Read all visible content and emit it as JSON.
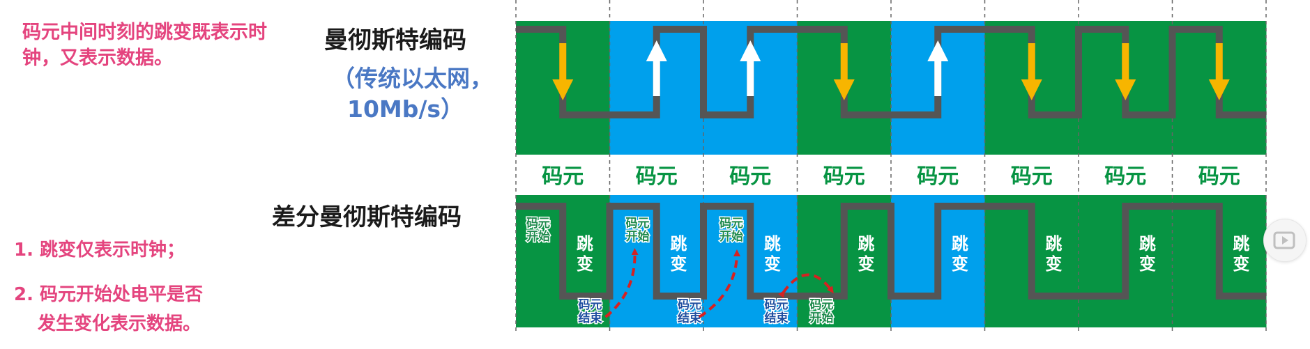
{
  "notes": {
    "manchester_note": "码元中间时刻的跳变既表示时钟，又表示数据。",
    "diff_rule_1": "1. 跳变仅表示时钟；",
    "diff_rule_2_line1": "2. 码元开始处电平是否",
    "diff_rule_2_line2": "发生变化表示数据。"
  },
  "manchester": {
    "title": "曼彻斯特编码",
    "subtitle_line1": "（传统以太网，",
    "subtitle_line2": "10Mb/s）",
    "mid_transitions": [
      "down",
      "up",
      "up",
      "down",
      "up",
      "down",
      "down",
      "down"
    ]
  },
  "symbol_label": "码元",
  "differential": {
    "title": "差分曼彻斯特编码",
    "mid_label_top": "跳",
    "mid_label_bottom": "变",
    "start_label_top": "码元",
    "start_label_bottom": "开始",
    "end_label_top": "码元",
    "end_label_bottom": "结束"
  },
  "colors": {
    "green": "#079443",
    "blue": "#00a0ec",
    "signal": "#555555",
    "arrow_down": "#f7b500",
    "arrow_up": "#ffffff",
    "curve": "#d52222",
    "symbol_text": "#079443"
  },
  "icons": {
    "play": "play-icon"
  }
}
